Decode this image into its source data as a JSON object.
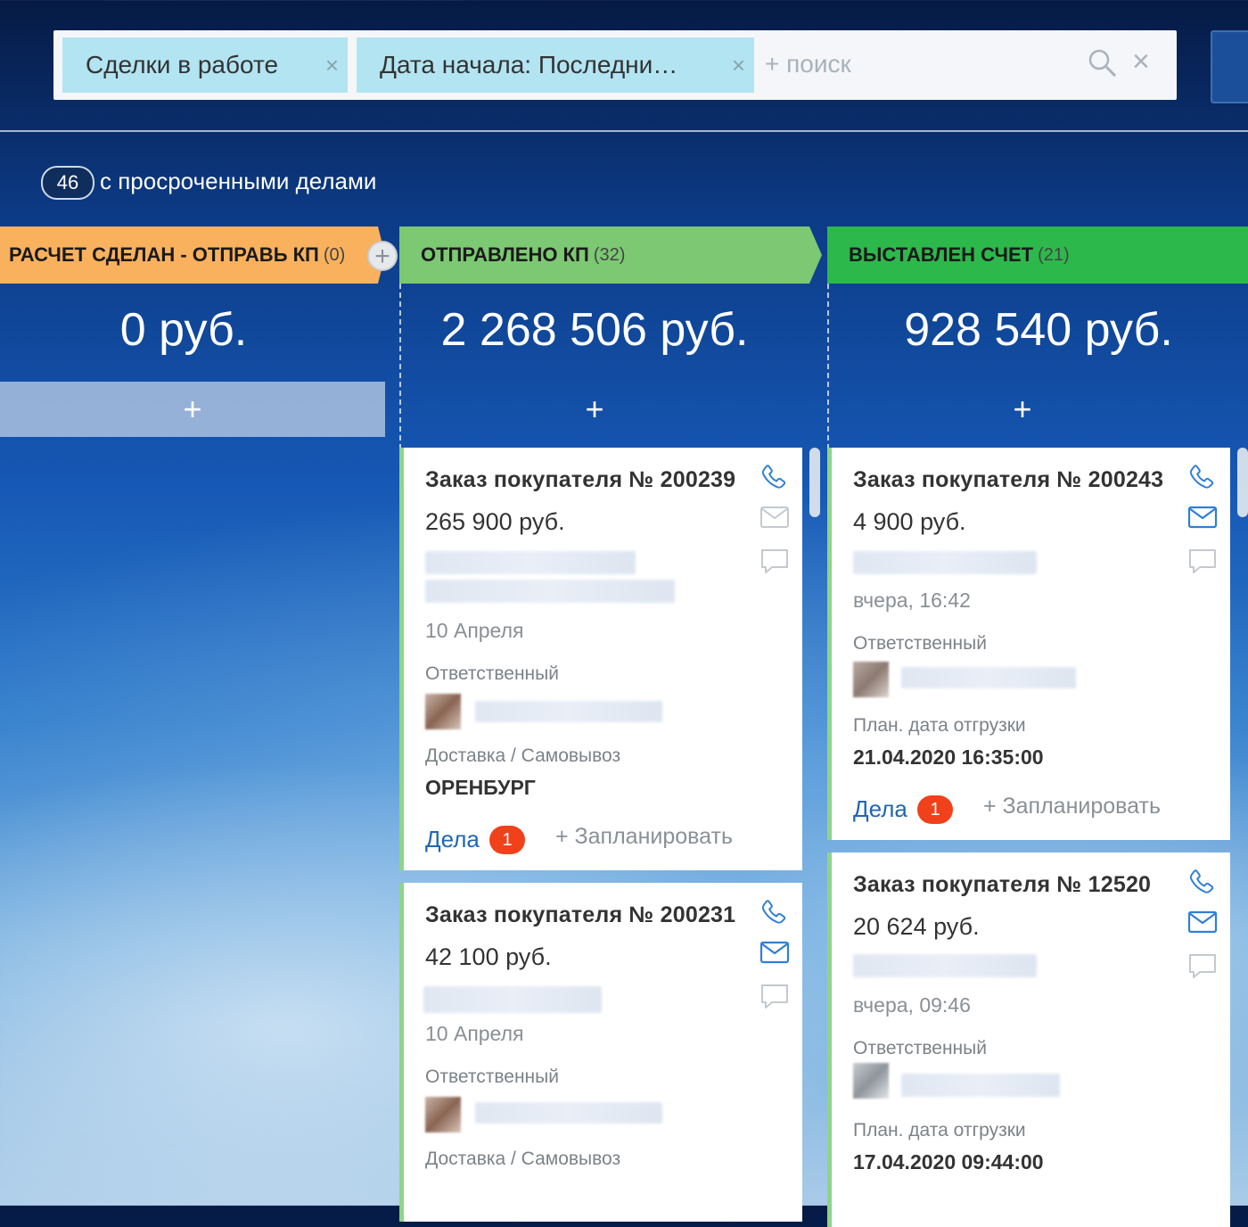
{
  "filter": {
    "chips": [
      "Сделки в работе",
      "Дата начала: Последни…"
    ],
    "chip_remove": "×",
    "search_placeholder": "+ поиск",
    "clear": "×"
  },
  "overdue": {
    "count": "46",
    "text": "с просроченными делами"
  },
  "stages": [
    {
      "name": "РАСЧЕТ СДЕЛАН - ОТПРАВЬ КП",
      "count": "(0)",
      "sum": "0 руб.",
      "color": "#f9b15d"
    },
    {
      "name": "ОТПРАВЛЕНО КП",
      "count": "(32)",
      "sum": "2 268 506 руб.",
      "color": "#7cc873"
    },
    {
      "name": "ВЫСТАВЛЕН СЧЕТ",
      "count": "(21)",
      "sum": "928 540 руб.",
      "color": "#2db84b"
    }
  ],
  "stage_add": "+",
  "add_deal": "+",
  "cards": [
    {
      "title": "Заказ покупателя № 200239",
      "price": "265 900 руб.",
      "date": "10 Апреля",
      "resp_label": "Ответственный",
      "extra_label": "Доставка / Самовывоз",
      "extra_value": "ОРЕНБУРГ",
      "deals_label": "Дела",
      "deals_count": "1",
      "plan_label": "+ Запланировать"
    },
    {
      "title": "Заказ покупателя № 200231",
      "price": "42 100 руб.",
      "date": "10 Апреля",
      "resp_label": "Ответственный",
      "extra_label": "Доставка / Самовывоз"
    },
    {
      "title": "Заказ покупателя № 200243",
      "price": "4 900 руб.",
      "date": "вчера, 16:42",
      "resp_label": "Ответственный",
      "extra_label": "План. дата отгрузки",
      "extra_value": "21.04.2020 16:35:00",
      "deals_label": "Дела",
      "deals_count": "1",
      "plan_label": "+ Запланировать"
    },
    {
      "title": "Заказ покупателя № 12520",
      "price": "20 624 руб.",
      "date": "вчера, 09:46",
      "resp_label": "Ответственный",
      "extra_label": "План. дата отгрузки",
      "extra_value": "17.04.2020 09:44:00"
    }
  ],
  "icons": {
    "phone": "phone-icon",
    "mail": "mail-icon",
    "comment": "comment-icon",
    "search": "search-icon"
  },
  "colors": {
    "link": "#2067b0",
    "badge": "#f0411b",
    "icon_active": "#2f7fd6",
    "icon_inactive": "#c4c9ce"
  }
}
